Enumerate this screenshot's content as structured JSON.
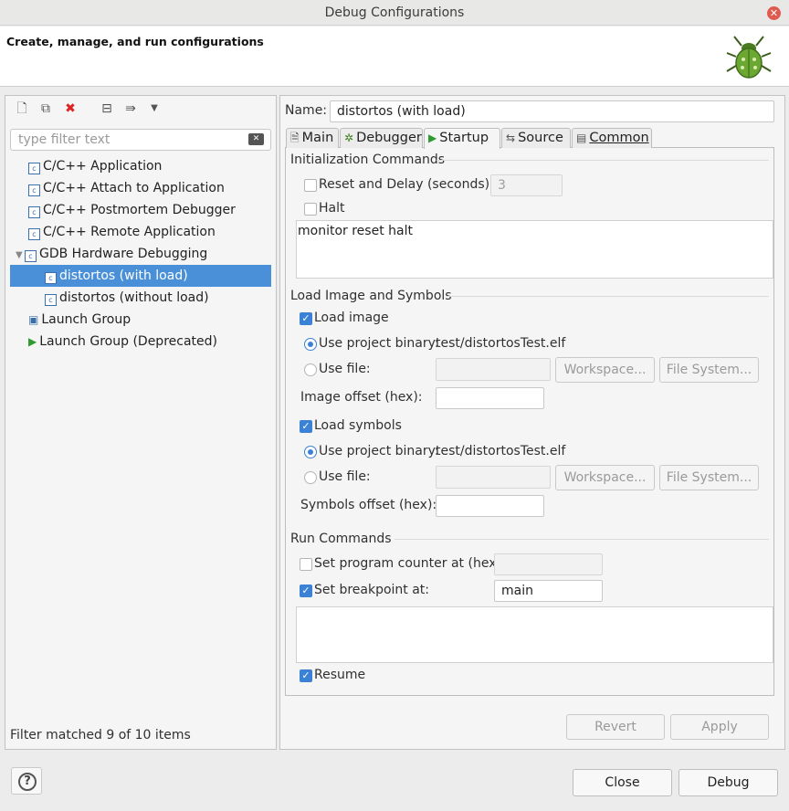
{
  "window": {
    "title": "Debug Configurations"
  },
  "banner": {
    "message": "Create, manage, and run configurations"
  },
  "left": {
    "filter_placeholder": "type filter text",
    "tree": [
      {
        "label": "C/C++ Application"
      },
      {
        "label": "C/C++ Attach to Application"
      },
      {
        "label": "C/C++ Postmortem Debugger"
      },
      {
        "label": "C/C++ Remote Application"
      },
      {
        "label": "GDB Hardware Debugging"
      },
      {
        "label": "distortos (with load)"
      },
      {
        "label": "distortos (without load)"
      },
      {
        "label": "Launch Group"
      },
      {
        "label": "Launch Group (Deprecated)"
      }
    ],
    "status": "Filter matched 9 of 10 items"
  },
  "right": {
    "name_label": "Name:",
    "name_value": "distortos (with load)",
    "tabs": [
      {
        "label": "Main"
      },
      {
        "label": "Debugger"
      },
      {
        "label": "Startup"
      },
      {
        "label": "Source"
      },
      {
        "label": "Common"
      }
    ],
    "init": {
      "title": "Initialization Commands",
      "reset_label": "Reset and Delay (seconds):",
      "reset_value": "3",
      "halt_label": "Halt",
      "commands": "monitor reset halt"
    },
    "load": {
      "title": "Load Image and Symbols",
      "load_image_label": "Load image",
      "use_project_binary_label": "Use project binary:",
      "project_binary": "test/distortosTest.elf",
      "use_file_label": "Use file:",
      "workspace_btn": "Workspace...",
      "filesystem_btn": "File System...",
      "image_offset_label": "Image offset (hex):",
      "load_symbols_label": "Load symbols",
      "symbols_offset_label": "Symbols offset (hex):"
    },
    "run": {
      "title": "Run Commands",
      "set_pc_label": "Set program counter at (hex):",
      "set_bp_label": "Set breakpoint at:",
      "bp_value": "main",
      "resume_label": "Resume"
    },
    "revert_btn": "Revert",
    "apply_btn": "Apply"
  },
  "footer": {
    "close_btn": "Close",
    "debug_btn": "Debug"
  }
}
